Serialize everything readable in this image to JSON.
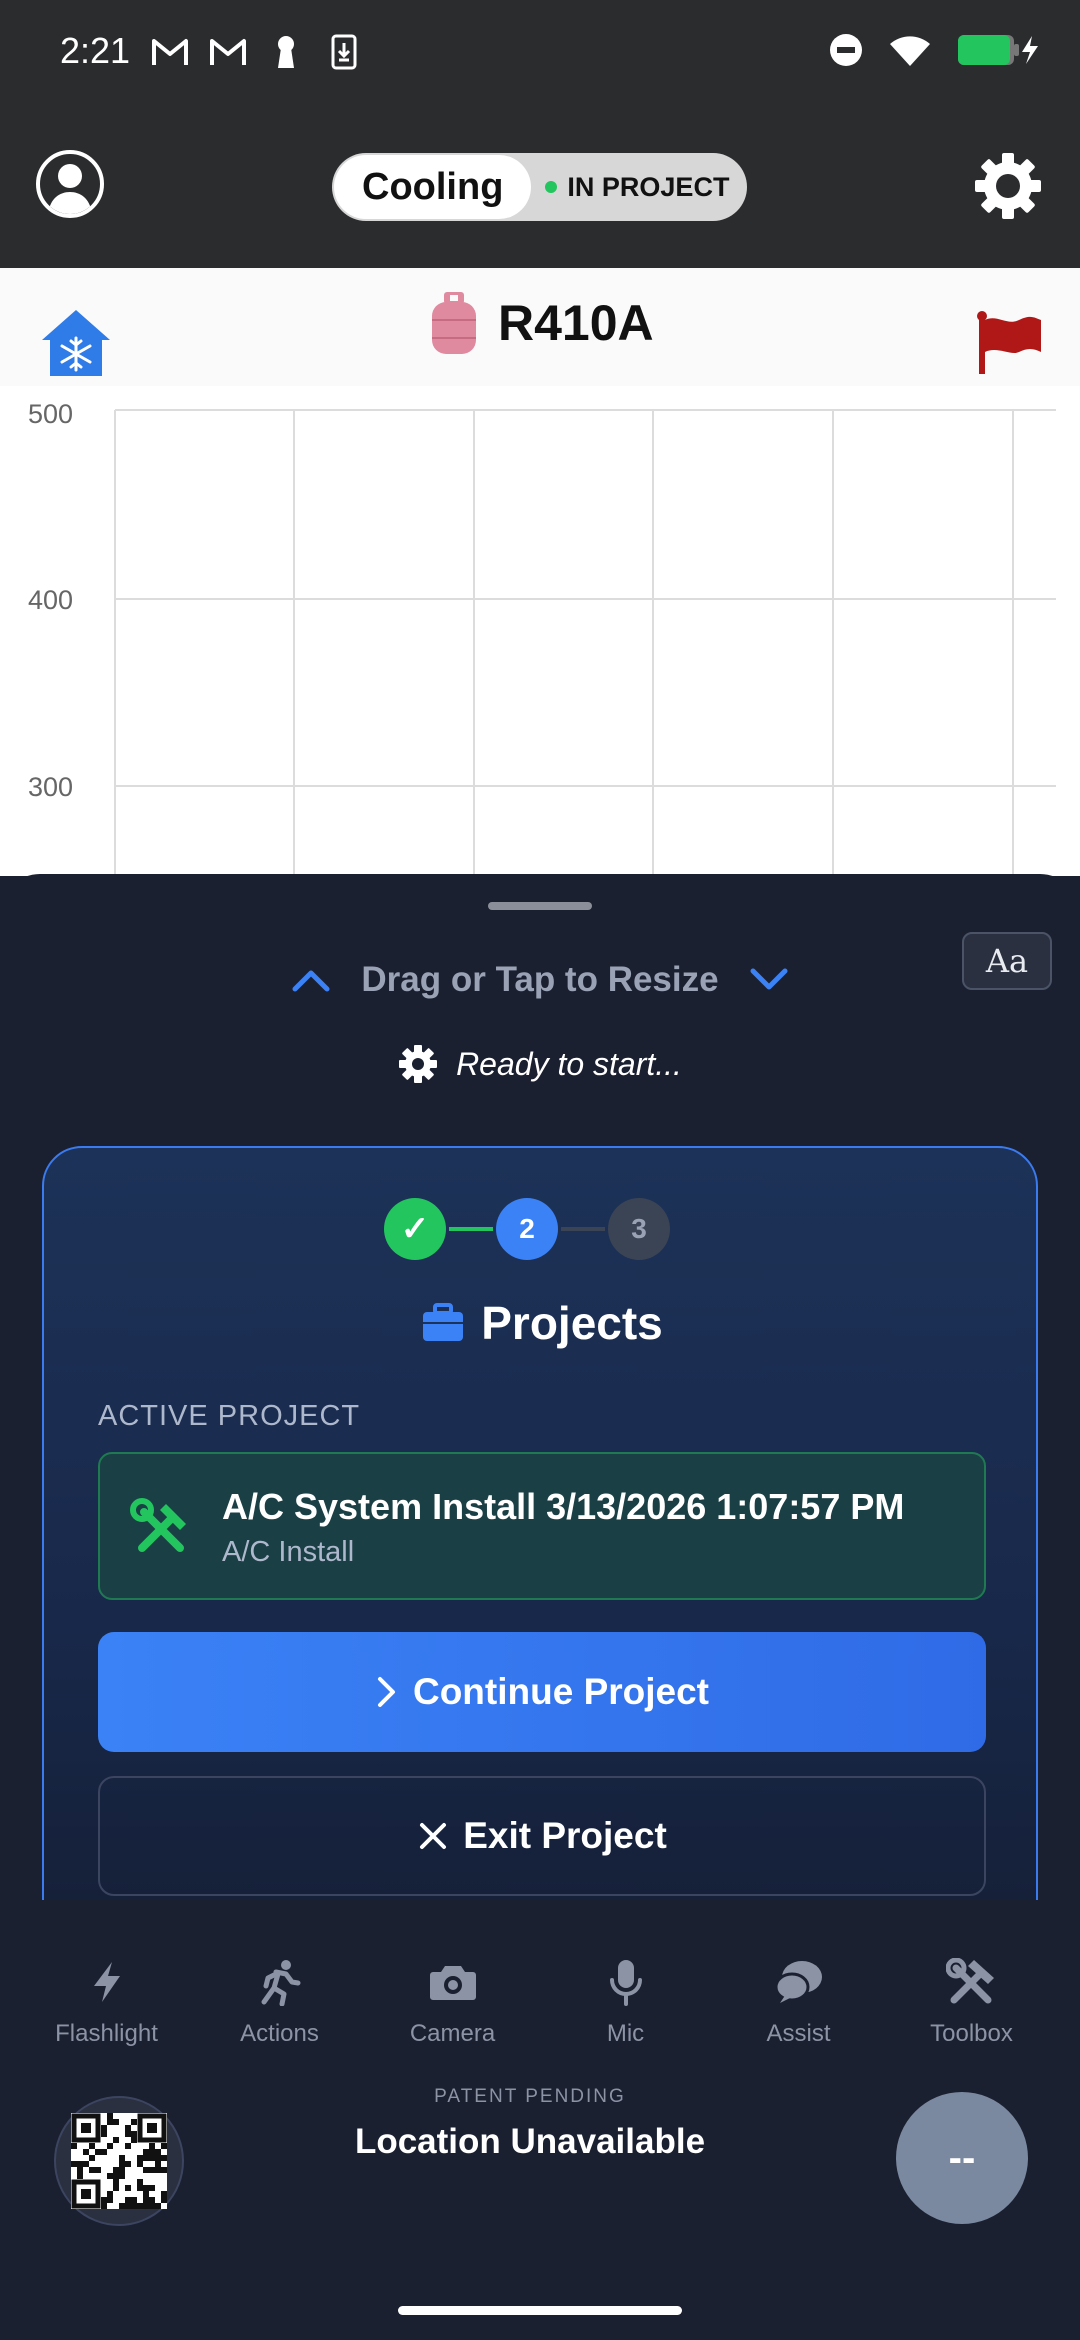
{
  "status_bar": {
    "time": "2:21",
    "left_icons": [
      "gmail-icon",
      "gmail-icon",
      "keyhole-icon",
      "download-phone-icon"
    ],
    "right_icons": [
      "do-not-disturb-icon",
      "wifi-icon",
      "battery-charging-icon"
    ]
  },
  "header": {
    "mode_label": "Cooling",
    "status_label": "IN PROJECT",
    "status_color": "#22c55e"
  },
  "refrigerant": {
    "label": "R410A"
  },
  "chart_data": {
    "type": "line",
    "title": "",
    "xlabel": "",
    "ylabel": "",
    "y_ticks": [
      "500",
      "400",
      "300"
    ],
    "grid": true,
    "series": []
  },
  "sheet": {
    "aa_label": "Aa",
    "resize_label": "Drag or Tap to Resize",
    "ready_text": "Ready to start...",
    "card": {
      "steps": [
        {
          "label": "✓",
          "state": "done"
        },
        {
          "label": "2",
          "state": "active"
        },
        {
          "label": "3",
          "state": "pending"
        }
      ],
      "title": "Projects",
      "section_label": "ACTIVE PROJECT",
      "project_name": "A/C System Install 3/13/2026 1:07:57 PM",
      "project_type": "A/C Install",
      "continue_label": "Continue Project",
      "exit_label": "Exit Project"
    }
  },
  "nav": {
    "items": [
      {
        "label": "Flashlight",
        "icon": "flashlight-icon"
      },
      {
        "label": "Actions",
        "icon": "running-person-icon"
      },
      {
        "label": "Camera",
        "icon": "camera-icon"
      },
      {
        "label": "Mic",
        "icon": "mic-icon"
      },
      {
        "label": "Assist",
        "icon": "chat-bubbles-icon"
      },
      {
        "label": "Toolbox",
        "icon": "tools-icon"
      }
    ],
    "patent": "PATENT PENDING",
    "location": "Location Unavailable",
    "round_button_label": "--"
  },
  "colors": {
    "accent_blue": "#3b82f6",
    "success_green": "#22c55e",
    "sheet_bg": "#1b2030",
    "flag_red": "#b01818",
    "tank_pink": "#e08aa0"
  }
}
